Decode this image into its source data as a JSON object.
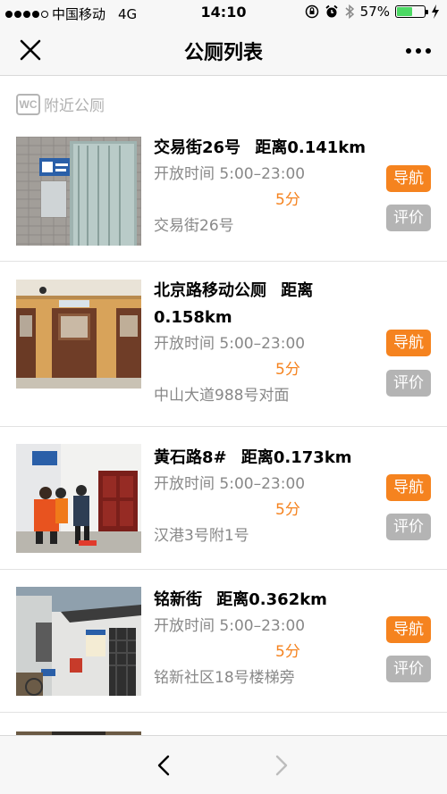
{
  "status_bar": {
    "carrier": "中国移动",
    "network": "4G",
    "time": "14:10",
    "battery": "57%",
    "battery_level": 0.57
  },
  "nav": {
    "title": "公厕列表"
  },
  "section": {
    "icon_text": "WC",
    "label": "附近公厕"
  },
  "items": [
    {
      "name": "交易街26号",
      "distance": "距离0.141km",
      "hours": "开放时间 5:00–23:00",
      "score": "5分",
      "address": "交易街26号",
      "nav_label": "导航",
      "rate_label": "评价"
    },
    {
      "name": "北京路移动公厕",
      "distance": "距离",
      "distance2": "0.158km",
      "hours": "开放时间 5:00–23:00",
      "score": "5分",
      "address": "中山大道988号对面",
      "nav_label": "导航",
      "rate_label": "评价"
    },
    {
      "name": "黄石路8#",
      "distance": "距离0.173km",
      "hours": "开放时间 5:00–23:00",
      "score": "5分",
      "address": "汉港3号附1号",
      "nav_label": "导航",
      "rate_label": "评价"
    },
    {
      "name": "铭新街",
      "distance": "距离0.362km",
      "hours": "开放时间 5:00–23:00",
      "score": "5分",
      "address": "铭新社区18号楼梯旁",
      "nav_label": "导航",
      "rate_label": "评价"
    }
  ],
  "colors": {
    "accent": "#f5831f",
    "rate_button": "#b4b4b4",
    "muted_text": "#888888"
  }
}
